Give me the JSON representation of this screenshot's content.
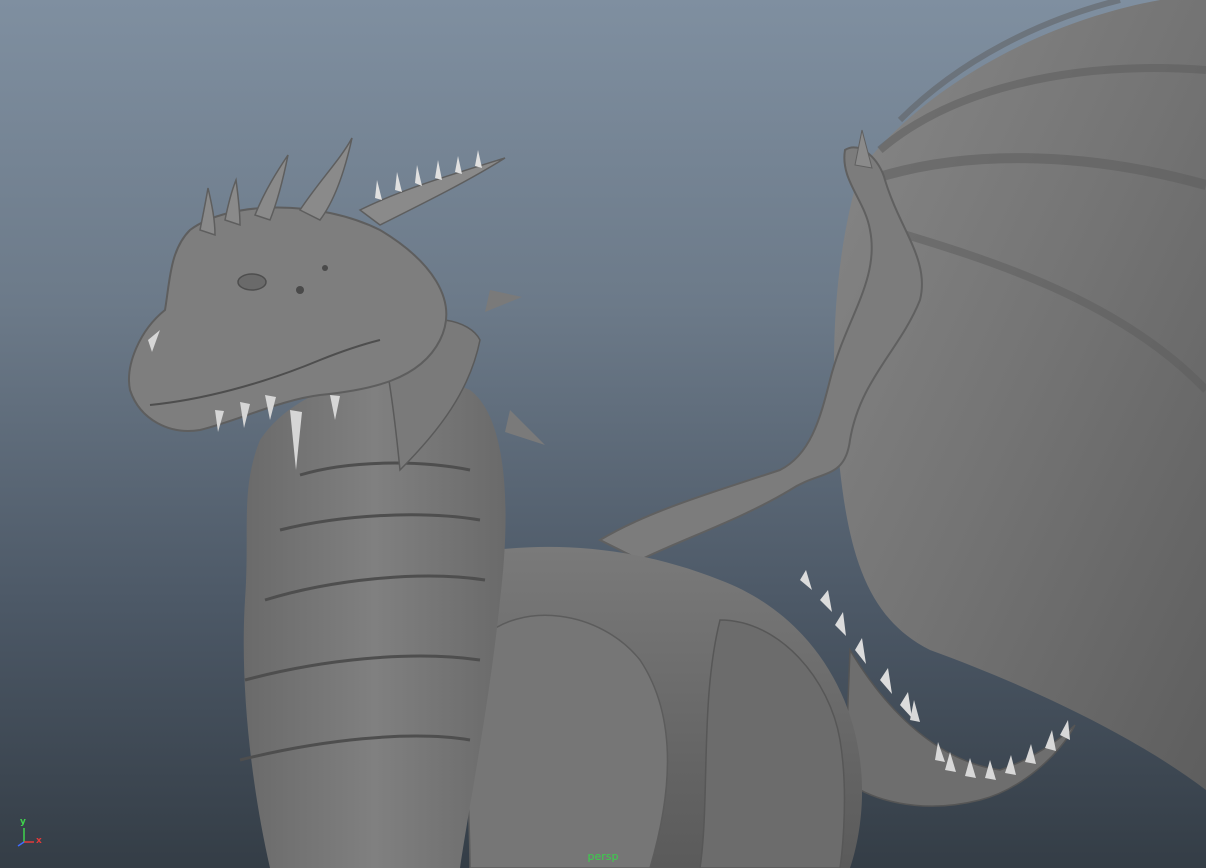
{
  "viewport": {
    "camera_name": "persp",
    "label_color": "#39d14a"
  },
  "axis_gizmo": {
    "y_label": "y",
    "x_label": "x",
    "y_color": "#3fd34c",
    "x_color": "#e23a3a",
    "z_color": "#3f6cff"
  },
  "scene": {
    "subject": "dragon-sculpt-model",
    "background_top": "#7f8fa0",
    "background_bottom": "#343d46",
    "model_color": "#707070"
  }
}
